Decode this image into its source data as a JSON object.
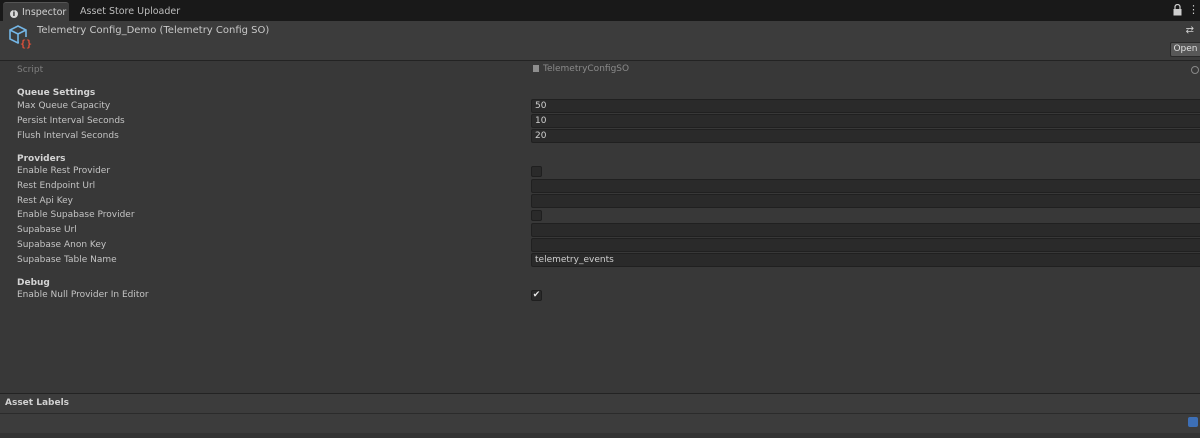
{
  "tabs": [
    {
      "label": "Inspector",
      "active": true
    },
    {
      "label": "Asset Store Uploader",
      "active": false
    }
  ],
  "header": {
    "title": "Telemetry Config_Demo (Telemetry Config SO)",
    "open_label": "Open"
  },
  "script_row": {
    "label": "Script",
    "value": "TelemetryConfigSO"
  },
  "sections": {
    "queue": {
      "heading": "Queue Settings",
      "fields": [
        {
          "label": "Max Queue Capacity",
          "value": "50"
        },
        {
          "label": "Persist Interval Seconds",
          "value": "10"
        },
        {
          "label": "Flush Interval Seconds",
          "value": "20"
        }
      ]
    },
    "providers": {
      "heading": "Providers",
      "fields": [
        {
          "label": "Enable Rest Provider",
          "type": "checkbox",
          "checked": false
        },
        {
          "label": "Rest Endpoint Url",
          "value": ""
        },
        {
          "label": "Rest Api Key",
          "value": ""
        },
        {
          "label": "Enable Supabase Provider",
          "type": "checkbox",
          "checked": false
        },
        {
          "label": "Supabase Url",
          "value": ""
        },
        {
          "label": "Supabase Anon Key",
          "value": ""
        },
        {
          "label": "Supabase Table Name",
          "value": "telemetry_events"
        }
      ]
    },
    "debug": {
      "heading": "Debug",
      "fields": [
        {
          "label": "Enable Null Provider In Editor",
          "type": "checkbox",
          "checked": true,
          "check_glyph": "✔"
        }
      ]
    }
  },
  "asset_labels": {
    "title": "Asset Labels"
  },
  "icons": {
    "info": "info-icon",
    "lock": "lock-icon",
    "menu": "kebab-menu-icon",
    "asset": "scriptable-object-icon",
    "settings": "preset-settings-icon",
    "script": "script-file-icon",
    "picker": "object-picker-icon",
    "tag": "label-tag-icon"
  },
  "colors": {
    "background": "#383838",
    "header": "#3c3c3c",
    "field": "#2a2a2a",
    "accent": "#3d6fb6"
  }
}
